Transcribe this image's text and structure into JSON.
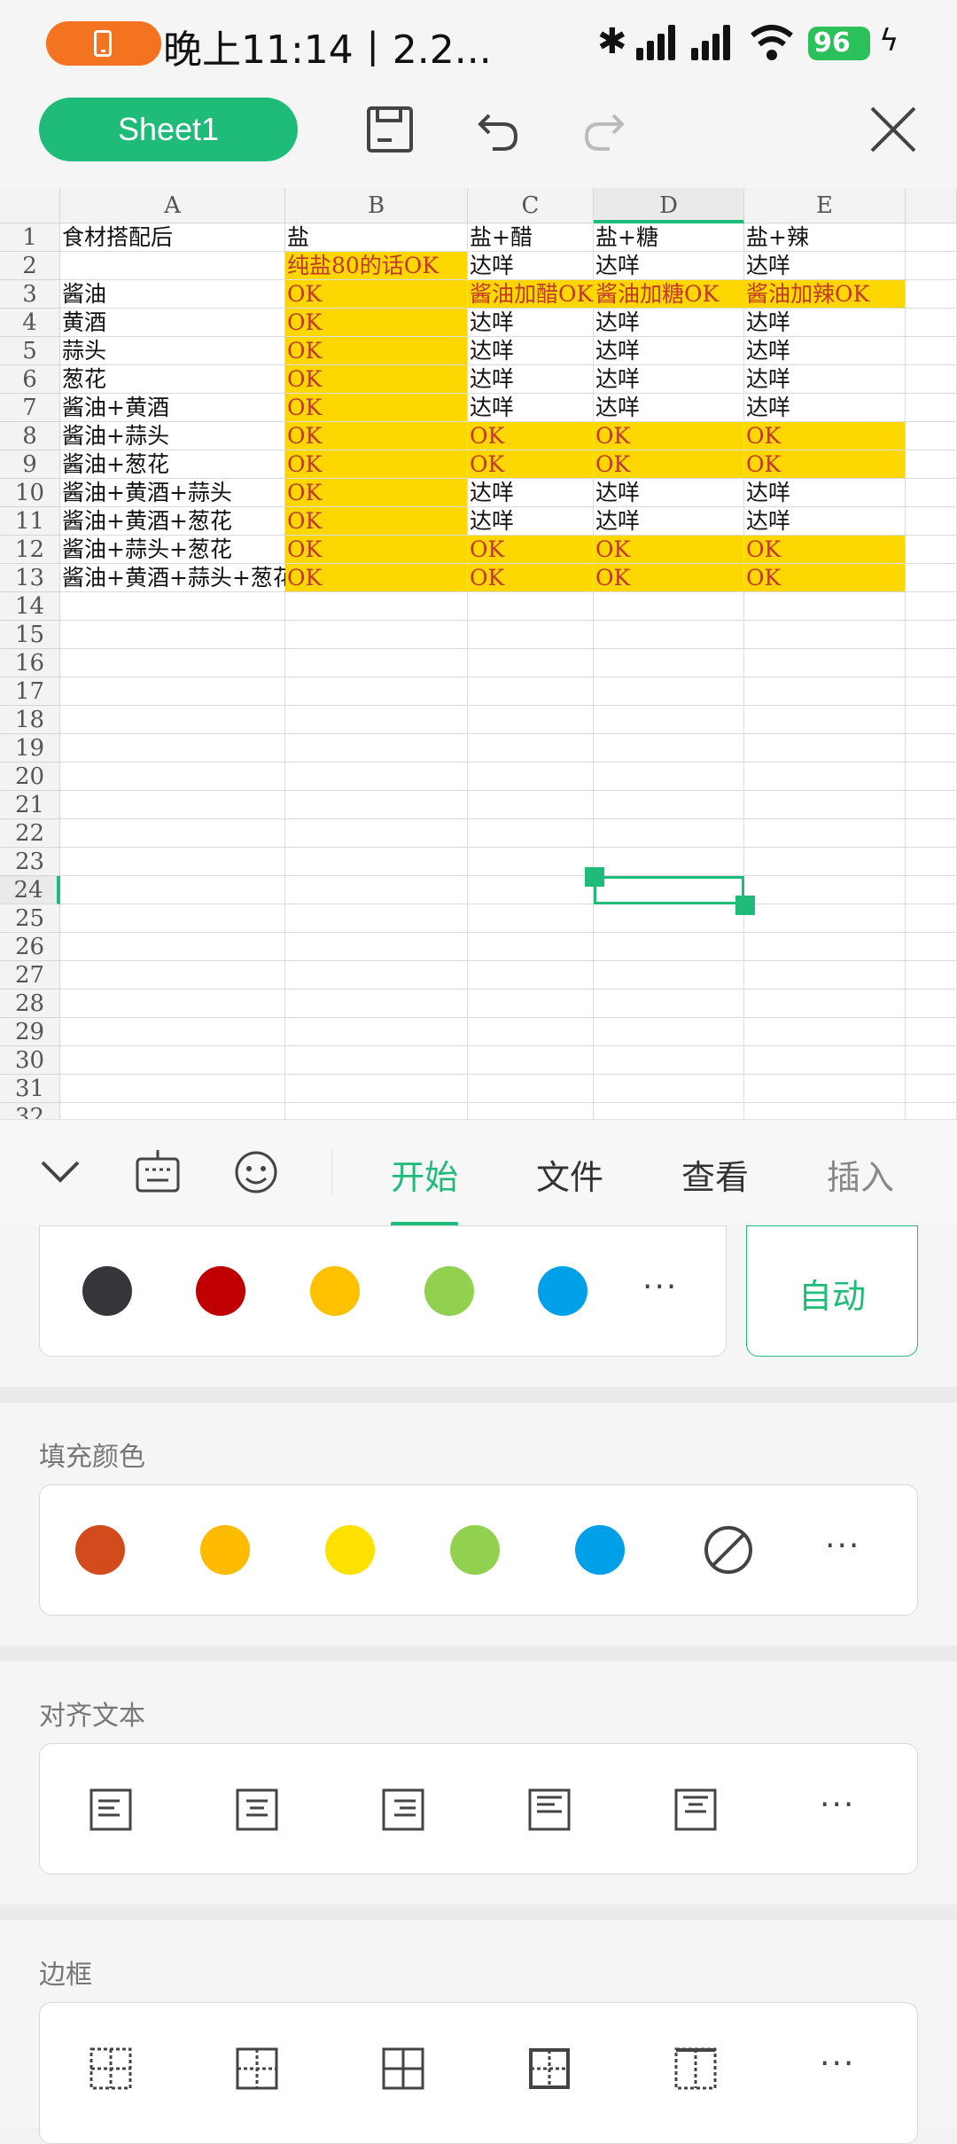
{
  "status": {
    "time": "晚上11:14丨2.2...",
    "battery": "96"
  },
  "toolbar": {
    "sheet_name": "Sheet1"
  },
  "grid": {
    "columns": [
      "A",
      "B",
      "C",
      "D",
      "E"
    ],
    "rows": [
      [
        "食材搭配后",
        "盐",
        "盐+醋",
        "盐+糖",
        "盐+辣"
      ],
      [
        "",
        "纯盐80的话OK",
        "达咩",
        "达咩",
        "达咩"
      ],
      [
        "酱油",
        "OK",
        "酱油加醋OK",
        "酱油加糖OK",
        "酱油加辣OK"
      ],
      [
        "黄酒",
        "OK",
        "达咩",
        "达咩",
        "达咩"
      ],
      [
        "蒜头",
        "OK",
        "达咩",
        "达咩",
        "达咩"
      ],
      [
        "葱花",
        "OK",
        "达咩",
        "达咩",
        "达咩"
      ],
      [
        "酱油+黄酒",
        "OK",
        "达咩",
        "达咩",
        "达咩"
      ],
      [
        "酱油+蒜头",
        "OK",
        "OK",
        "OK",
        "OK"
      ],
      [
        "酱油+葱花",
        "OK",
        "OK",
        "OK",
        "OK"
      ],
      [
        "酱油+黄酒+蒜头",
        "OK",
        "达咩",
        "达咩",
        "达咩"
      ],
      [
        "酱油+黄酒+葱花",
        "OK",
        "达咩",
        "达咩",
        "达咩"
      ],
      [
        "酱油+蒜头+葱花",
        "OK",
        "OK",
        "OK",
        "OK"
      ],
      [
        "酱油+黄酒+蒜头+葱花",
        "OK",
        "OK",
        "OK",
        "OK"
      ]
    ],
    "highlighted_rows": [
      3,
      8,
      9,
      12,
      13
    ],
    "highlighted_column": "B",
    "highlight_color": "#ffd700",
    "highlight_text_color": "#c0392b",
    "row_count_visible": 32,
    "selected_cell": "D24"
  },
  "panel": {
    "tabs": [
      "开始",
      "文件",
      "查看",
      "插入"
    ],
    "active_tab": "开始",
    "font_colors": [
      "#35363a",
      "#c00000",
      "#ffc000",
      "#92d050",
      "#00a0e9"
    ],
    "auto_label": "自动",
    "fill_title": "填充颜色",
    "fill_colors": [
      "#d24b1c",
      "#ffbb00",
      "#ffe100",
      "#92d050",
      "#00a0e9"
    ],
    "align_title": "对齐文本",
    "border_title": "边框",
    "more": "···"
  }
}
